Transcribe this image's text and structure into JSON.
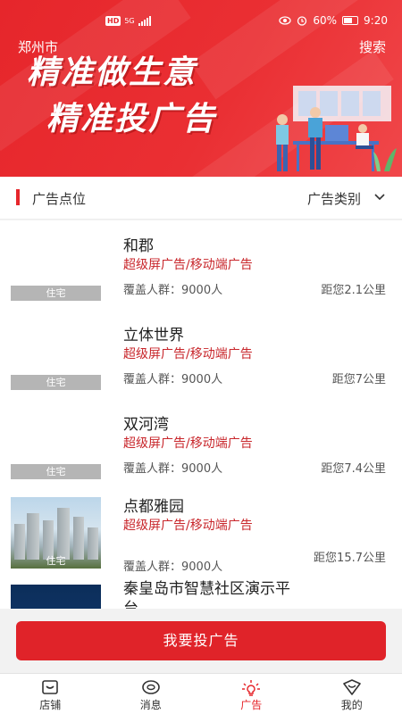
{
  "status_bar": {
    "hd": "HD",
    "network": "5G",
    "battery": "60%",
    "time": "9:20"
  },
  "header": {
    "city": "郑州市",
    "search": "搜索"
  },
  "banner": {
    "line1": "精准做生意",
    "line2": "精准投广告"
  },
  "section": {
    "title": "广告点位",
    "filter": "广告类别"
  },
  "listings": [
    {
      "name": "和郡",
      "ad_type": "超级屏广告/移动端广告",
      "coverage": "覆盖人群：9000人",
      "distance": "距您2.1公里",
      "tag": "住宅"
    },
    {
      "name": "立体世界",
      "ad_type": "超级屏广告/移动端广告",
      "coverage": "覆盖人群：9000人",
      "distance": "距您7公里",
      "tag": "住宅"
    },
    {
      "name": "双河湾",
      "ad_type": "超级屏广告/移动端广告",
      "coverage": "覆盖人群：9000人",
      "distance": "距您7.4公里",
      "tag": "住宅"
    },
    {
      "name": "点都雅园",
      "ad_type": "超级屏广告/移动端广告",
      "coverage": "覆盖人群：9000人",
      "distance": "距您15.7公里",
      "tag": "住宅"
    },
    {
      "name": "秦皇岛市智慧社区演示平台"
    }
  ],
  "cta": {
    "label": "我要投广告"
  },
  "tabs": [
    {
      "label": "店铺",
      "icon": "shop-icon"
    },
    {
      "label": "消息",
      "icon": "message-icon"
    },
    {
      "label": "广告",
      "icon": "ad-icon"
    },
    {
      "label": "我的",
      "icon": "profile-icon"
    }
  ],
  "colors": {
    "brand": "#e6262b",
    "ad_type_text": "#c8262b",
    "tag_bg": "#b5b5b5"
  }
}
